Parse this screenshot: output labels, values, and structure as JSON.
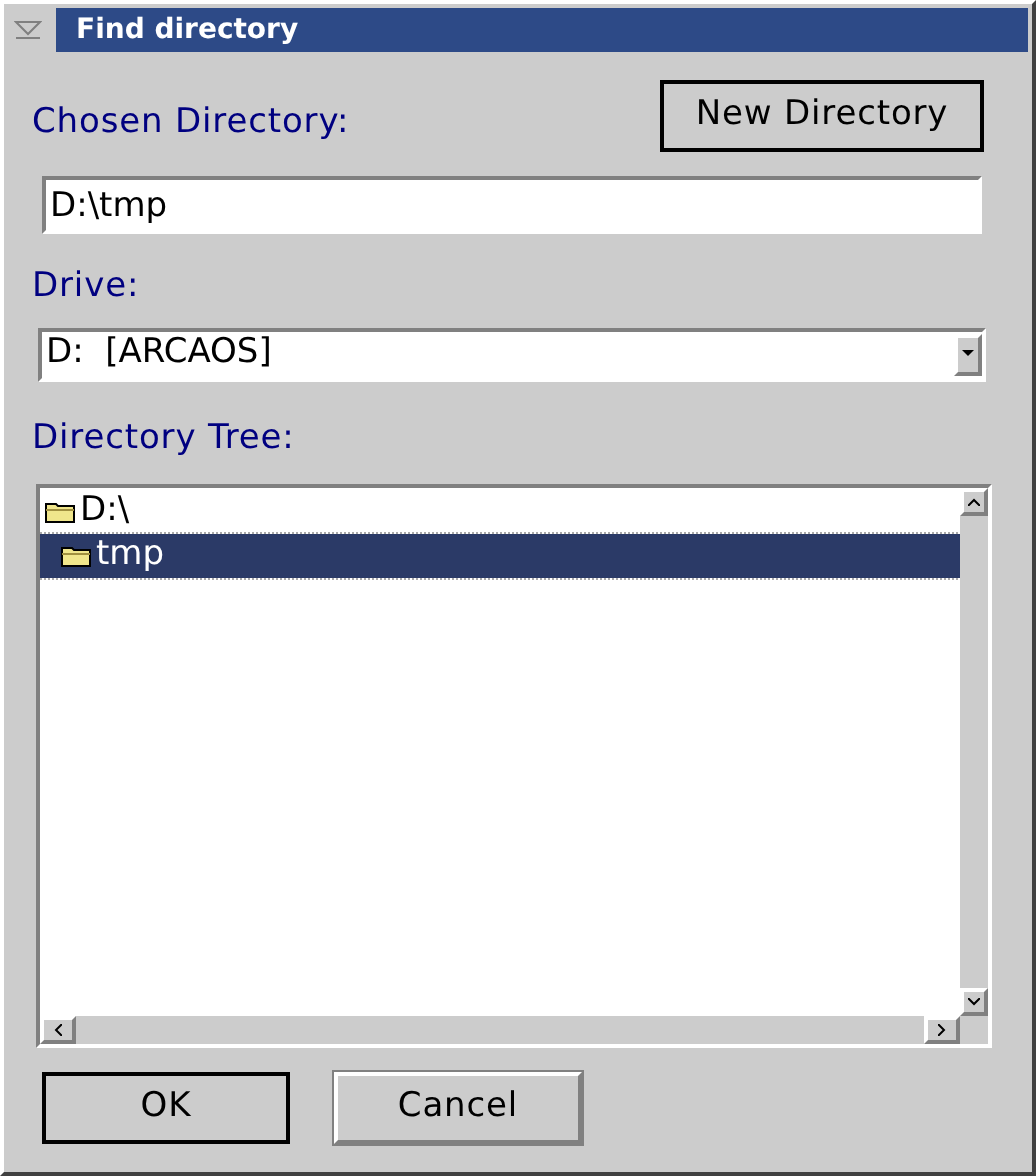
{
  "window": {
    "title": "Find directory"
  },
  "chosen_directory": {
    "label": "Chosen Directory:",
    "value": "D:\\tmp"
  },
  "new_directory_button": "New Directory",
  "drive": {
    "label": "Drive:",
    "value": "D:  [ARCAOS]"
  },
  "directory_tree": {
    "label": "Directory Tree:",
    "items": [
      {
        "label": "D:\\",
        "selected": false,
        "children": [
          {
            "label": "tmp",
            "selected": true
          }
        ]
      }
    ]
  },
  "buttons": [
    {
      "label": "OK",
      "default": true
    },
    {
      "label": "Cancel",
      "default": false
    }
  ]
}
